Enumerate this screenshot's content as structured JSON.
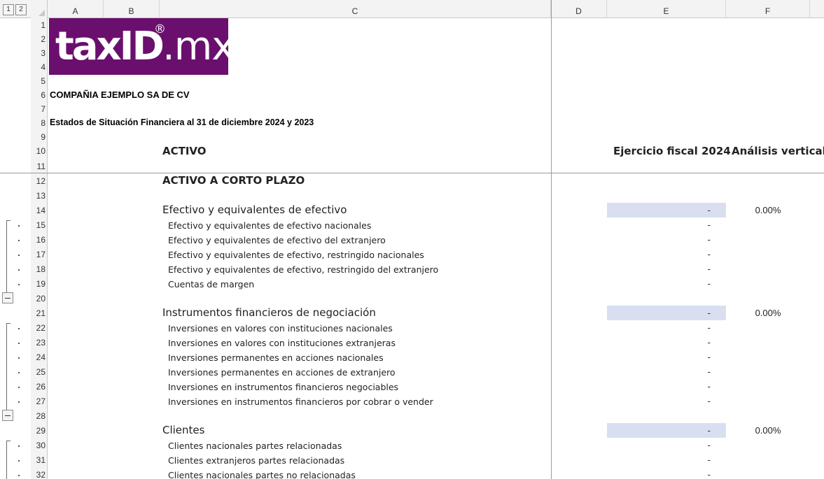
{
  "outline_levels": [
    "1",
    "2"
  ],
  "columns": [
    "A",
    "B",
    "C",
    "D",
    "E",
    "F"
  ],
  "rows": [
    "1",
    "2",
    "3",
    "4",
    "5",
    "6",
    "7",
    "8",
    "9",
    "10",
    "11",
    "12",
    "13",
    "14",
    "15",
    "16",
    "17",
    "18",
    "19",
    "20",
    "21",
    "22",
    "23",
    "24",
    "25",
    "26",
    "27",
    "28",
    "29",
    "30",
    "31",
    "32"
  ],
  "logo": {
    "text_bold": "taxID",
    "text_light": ".mx",
    "registered": "®",
    "bg_color": "#6b0f6e"
  },
  "company_name": "COMPAÑIA EJEMPLO SA DE CV",
  "report_title": "Estados de Situación Financiera al 31 de diciembre 2024 y 2023",
  "headers": {
    "activo": "ACTIVO",
    "ejercicio": "Ejercicio fiscal 2024",
    "analisis": "Análisis vertical"
  },
  "section_title": "ACTIVO A CORTO PLAZO",
  "groups": [
    {
      "label": "Efectivo y equivalentes de efectivo",
      "value": "-",
      "pct": "0.00%",
      "items": [
        {
          "label": "Efectivo y equivalentes de efectivo nacionales",
          "value": "-"
        },
        {
          "label": "Efectivo y equivalentes de efectivo del extranjero",
          "value": "-"
        },
        {
          "label": "Efectivo y equivalentes de efectivo, restringido nacionales",
          "value": "-"
        },
        {
          "label": "Efectivo y equivalentes de efectivo, restringido del extranjero",
          "value": "-"
        },
        {
          "label": "Cuentas de margen",
          "value": "-"
        }
      ]
    },
    {
      "label": "Instrumentos financieros de negociación",
      "value": "-",
      "pct": "0.00%",
      "items": [
        {
          "label": "Inversiones en valores con instituciones nacionales",
          "value": "-"
        },
        {
          "label": "Inversiones en valores con instituciones extranjeras",
          "value": "-"
        },
        {
          "label": "Inversiones permanentes en acciones nacionales",
          "value": "-"
        },
        {
          "label": "Inversiones permanentes en acciones  de extranjero",
          "value": "-"
        },
        {
          "label": "Inversiones en instrumentos financieros  negociables",
          "value": "-"
        },
        {
          "label": "Inversiones en instrumentos financieros por cobrar o vender",
          "value": "-"
        }
      ]
    },
    {
      "label": "Clientes",
      "value": "-",
      "pct": "0.00%",
      "items": [
        {
          "label": "Clientes nacionales partes relacionadas",
          "value": "-"
        },
        {
          "label": "Clientes extranjeros partes relacionadas",
          "value": "-"
        },
        {
          "label": "Clientes nacionales partes no relacionadas",
          "value": "-"
        }
      ]
    }
  ]
}
